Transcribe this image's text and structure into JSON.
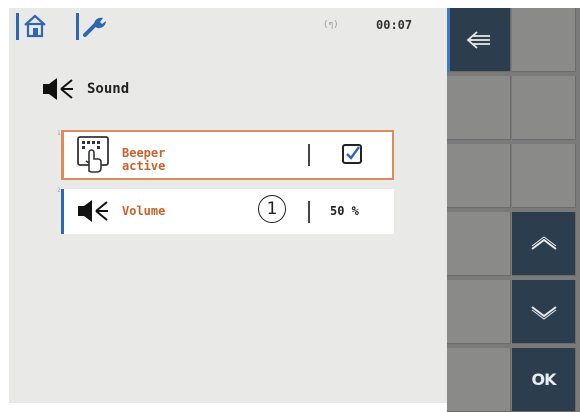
{
  "status_bar": {
    "home_icon": "home-icon",
    "settings_icon": "wrench-icon",
    "signal_text": "(ๆ)",
    "time": "00:07"
  },
  "section": {
    "icon": "speaker-icon",
    "title": "Sound"
  },
  "params": [
    {
      "index": "1",
      "icon": "beeper-hand-icon",
      "label": "Beeper\nactive",
      "label_line1": "Beeper",
      "label_line2": "active",
      "checked": true
    },
    {
      "index": "2",
      "icon": "speaker-icon",
      "label": "Volume",
      "value": "50 %",
      "callout": "1"
    }
  ],
  "softkeys": {
    "back_icon": "back-arrow-icon",
    "up_icon": "chevron-up-icon",
    "down_icon": "chevron-down-icon",
    "ok_label": "OK"
  },
  "colors": {
    "accent_blue": "#2f66b0",
    "label_orange": "#c9622a",
    "selected_border": "#d98c5f",
    "panel_bg": "#e9e9e8",
    "softkey_bg": "#8a8a88",
    "softkey_dark": "#2c3e4e"
  }
}
